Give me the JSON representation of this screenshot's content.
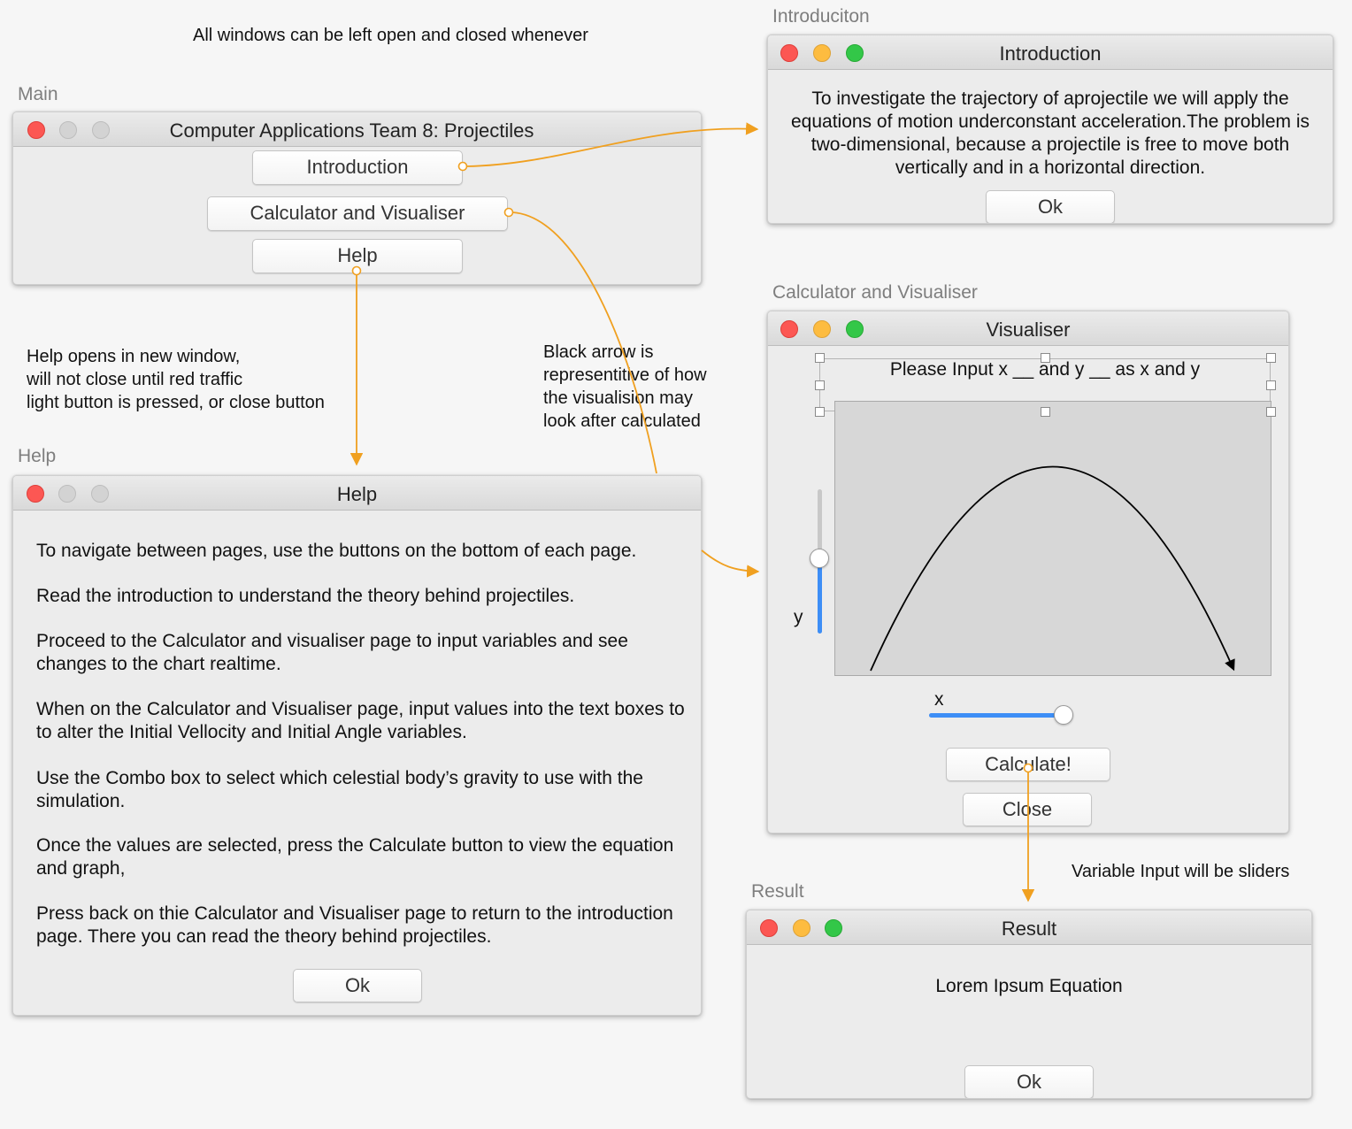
{
  "annotations": {
    "top_note": "All windows can be left open and closed whenever",
    "help_note": "Help opens in new window,\nwill not close until red traffic\nlight button is pressed, or close button",
    "arrow_note": "Black arrow is\nrepresentitive of how\nthe visualision may\nlook after calculated",
    "slider_note": "Variable Input will be sliders"
  },
  "labels": {
    "main": "Main",
    "introduction": "Introduciton",
    "calculator": "Calculator and Visualiser",
    "help": "Help",
    "result": "Result"
  },
  "main_window": {
    "title": "Computer Applications Team 8: Projectiles",
    "buttons": [
      "Introduction",
      "Calculator and Visualiser",
      "Help"
    ]
  },
  "intro_window": {
    "title": "Introduction",
    "text": "To investigate the trajectory of aprojectile we will apply the equations of motion underconstant acceleration.The problem is two-dimensional, because a projectile is free to move both vertically and in a horizontal direction.",
    "ok": "Ok"
  },
  "help_window": {
    "title": "Help",
    "paragraphs": [
      "To navigate between pages, use the buttons on the bottom of each page.",
      "Read the introduction to understand the theory behind projectiles.",
      "Proceed to the Calculator and visualiser page to input variables and see changes to the chart realtime.",
      "When on the Calculator and Visualiser page, input values into the text boxes to to alter the Initial Vellocity and Initial Angle variables.",
      "Use the Combo box to select which celestial body’s gravity to use with the simulation.",
      "Once the values are selected, press the Calculate button to view the equation and graph,",
      "Press back on thie Calculator and Visualiser page to return to the introduction page. There you can read the theory behind projectiles."
    ],
    "ok": "Ok"
  },
  "visualiser_window": {
    "title": "Visualiser",
    "prompt": "Please Input x __ and y __ as x and y",
    "y_label": "y",
    "x_label": "x",
    "y_slider_value": 0.52,
    "x_slider_value": 1.0,
    "calculate": "Calculate!",
    "close": "Close"
  },
  "result_window": {
    "title": "Result",
    "text": "Lorem Ipsum Equation",
    "ok": "Ok"
  },
  "colors": {
    "connector": "#f0a020",
    "slider_fill": "#3d8ef6",
    "light_red": "#fc5753",
    "light_yellow": "#fdbc40",
    "light_green": "#33c748"
  }
}
